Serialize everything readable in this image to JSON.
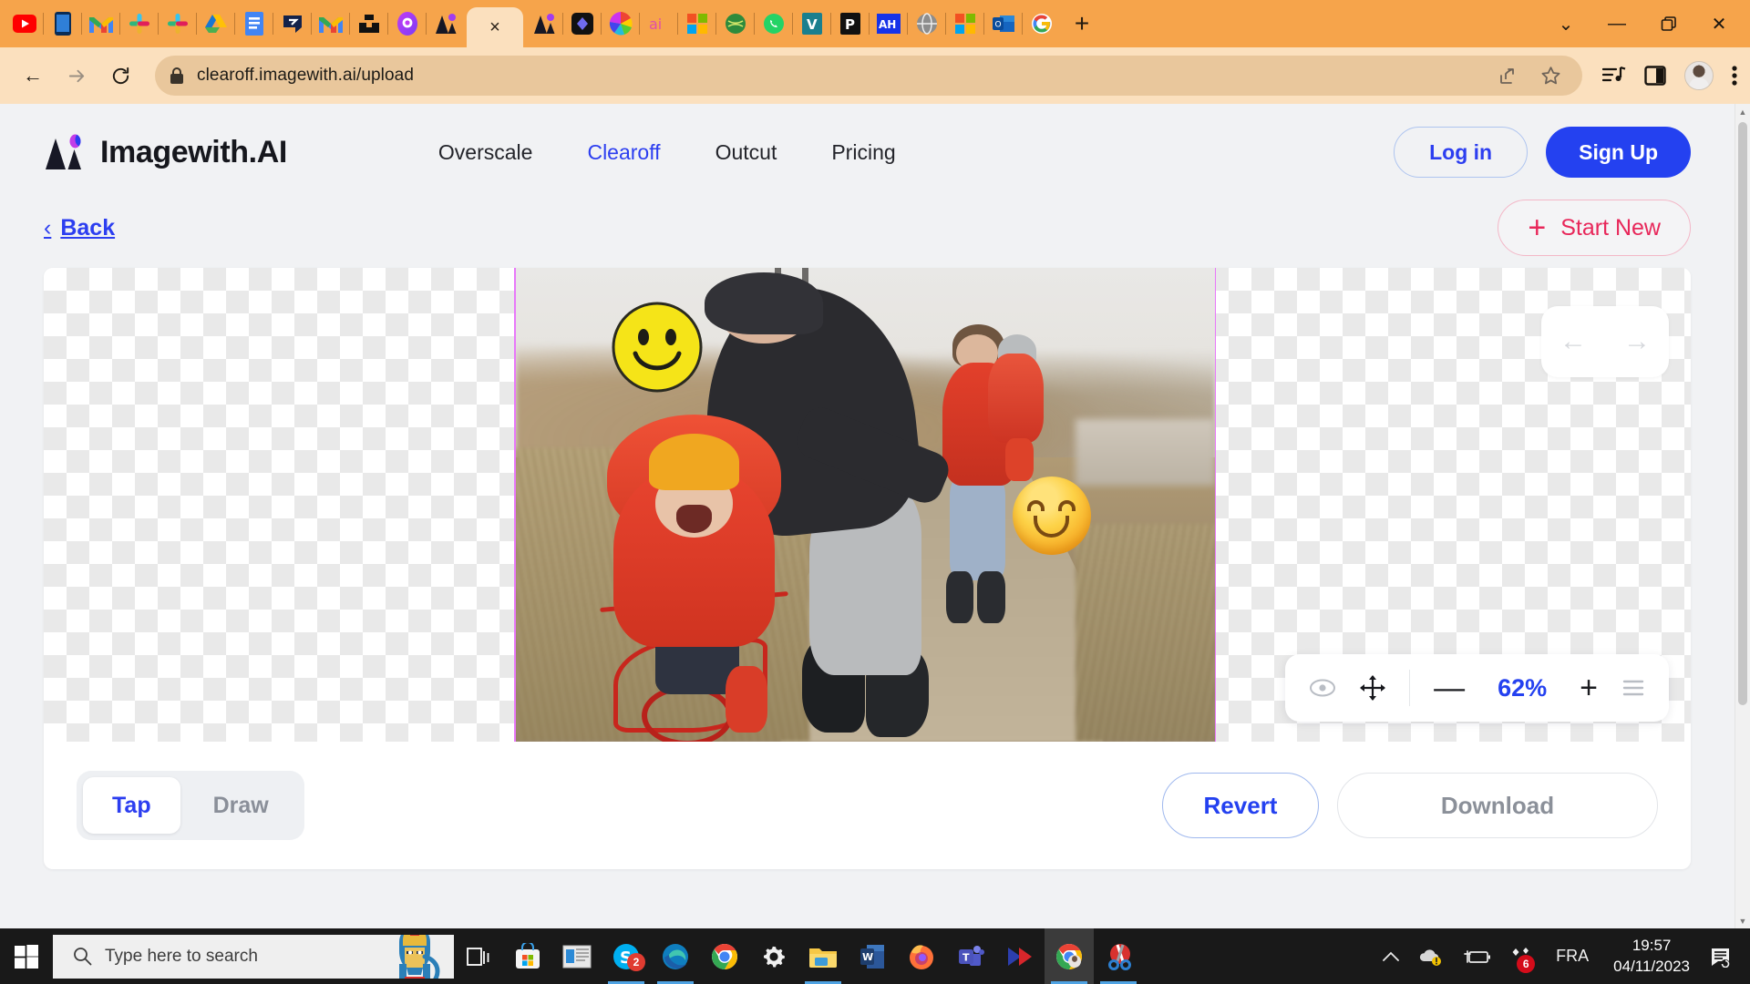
{
  "browser": {
    "url": "clearoff.imagewith.ai/upload",
    "lock_icon": "lock-icon",
    "bookmarks": [
      {
        "name": "youtube",
        "label": "YouTube"
      },
      {
        "name": "phone",
        "label": "Phone"
      },
      {
        "name": "gmail",
        "label": "Gmail"
      },
      {
        "name": "slack",
        "label": "Slack"
      },
      {
        "name": "slack-2",
        "label": "Slack"
      },
      {
        "name": "google-drive",
        "label": "Google Drive"
      },
      {
        "name": "google-docs",
        "label": "Docs"
      },
      {
        "name": "pitch",
        "label": "Pitch"
      },
      {
        "name": "gmail-2",
        "label": "Gmail"
      },
      {
        "name": "unsplash",
        "label": "Unsplash"
      },
      {
        "name": "picsart",
        "label": "PicsArt"
      },
      {
        "name": "imagewith-ai",
        "label": "Imagewith.AI"
      }
    ],
    "bookmarks_right": [
      {
        "name": "imagewith-ai-2",
        "label": "Imagewith.AI"
      },
      {
        "name": "diamond-app",
        "label": "App"
      },
      {
        "name": "color-wheel",
        "label": "Colors"
      },
      {
        "name": "ai-tool",
        "label": "AI Tool"
      },
      {
        "name": "microsoft",
        "label": "Microsoft"
      },
      {
        "name": "globe-green",
        "label": "Web"
      },
      {
        "name": "whatsapp",
        "label": "WhatsApp"
      },
      {
        "name": "vimeo",
        "label": "V"
      },
      {
        "name": "pinterest-dark",
        "label": "P"
      },
      {
        "name": "ah",
        "label": "AH"
      },
      {
        "name": "globe",
        "label": "Globe"
      },
      {
        "name": "microsoft-2",
        "label": "Microsoft"
      },
      {
        "name": "outlook",
        "label": "Outlook"
      },
      {
        "name": "google",
        "label": "Google"
      }
    ],
    "active_tab_close": "×",
    "new_tab": "+",
    "window_controls": {
      "minimize": "—",
      "maximize": "❐",
      "close": "✕",
      "chevron": "⌄"
    },
    "toolbar_icons": [
      {
        "name": "share-icon"
      },
      {
        "name": "bookmark-star-icon"
      },
      {
        "name": "media-playlist-icon"
      },
      {
        "name": "side-panel-icon"
      },
      {
        "name": "profile-avatar"
      },
      {
        "name": "chrome-menu-icon"
      }
    ],
    "nav_icons": {
      "back": "←",
      "forward": "→",
      "reload": "⟳"
    }
  },
  "site": {
    "brand": "Imagewith.AI",
    "nav": [
      {
        "label": "Overscale",
        "active": false
      },
      {
        "label": "Clearoff",
        "active": true
      },
      {
        "label": "Outcut",
        "active": false
      },
      {
        "label": "Pricing",
        "active": false
      }
    ],
    "login_label": "Log in",
    "signup_label": "Sign Up",
    "back_label": "Back",
    "back_chevron": "‹",
    "start_new_label": "Start New",
    "start_new_plus": "+",
    "accent_blue": "#2441F0",
    "accent_pink": "#E8275A"
  },
  "editor": {
    "canvas": {
      "stickers": [
        {
          "name": "smiley-classic-sticker",
          "emoji": "🙂"
        },
        {
          "name": "smiling-face-emoji",
          "emoji": "😊"
        }
      ],
      "photo_alt": "Father helping toddler on a red balance bike on a gravel path, mother carrying baby behind"
    },
    "history": {
      "undo": "←",
      "redo": "→"
    },
    "zoom_toolbar": {
      "eye_icon": "eye-icon",
      "pan_icon": "move-icon",
      "minus": "—",
      "value": "62%",
      "plus": "+",
      "menu_icon": "hamburger-icon"
    },
    "mode_tabs": [
      {
        "label": "Tap",
        "active": true
      },
      {
        "label": "Draw",
        "active": false
      }
    ],
    "revert_label": "Revert",
    "download_label": "Download"
  },
  "taskbar": {
    "start_icon": "windows-logo-icon",
    "search_placeholder": "Type here to search",
    "search_icon": "search-icon",
    "mascot": "pharaoh-icon",
    "apps": [
      {
        "name": "task-view-icon",
        "running": false,
        "active": false
      },
      {
        "name": "microsoft-store-icon",
        "running": false,
        "active": false
      },
      {
        "name": "news-icon",
        "running": false,
        "active": false
      },
      {
        "name": "skype-icon",
        "running": true,
        "active": false,
        "badge": "2"
      },
      {
        "name": "microsoft-edge-icon",
        "running": true,
        "active": false
      },
      {
        "name": "google-chrome-icon",
        "running": false,
        "active": false
      },
      {
        "name": "settings-gear-icon",
        "running": false,
        "active": false
      },
      {
        "name": "file-explorer-icon",
        "running": true,
        "active": false
      },
      {
        "name": "microsoft-word-icon",
        "running": false,
        "active": false
      },
      {
        "name": "firefox-icon",
        "running": false,
        "active": false
      },
      {
        "name": "microsoft-teams-icon",
        "running": false,
        "active": false
      },
      {
        "name": "media-player-icon",
        "running": false,
        "active": false
      },
      {
        "name": "google-chrome-icon-2",
        "running": true,
        "active": true
      },
      {
        "name": "snipping-tool-icon",
        "running": true,
        "active": false
      }
    ],
    "tray": {
      "chevron": "∧",
      "onedrive_icon": "onedrive-warning-icon",
      "battery_icon": "battery-charging-icon",
      "notifications_badge": "6",
      "language": "FRA",
      "time": "19:57",
      "date": "04/11/2023",
      "action_center_icon": "action-center-icon"
    }
  }
}
